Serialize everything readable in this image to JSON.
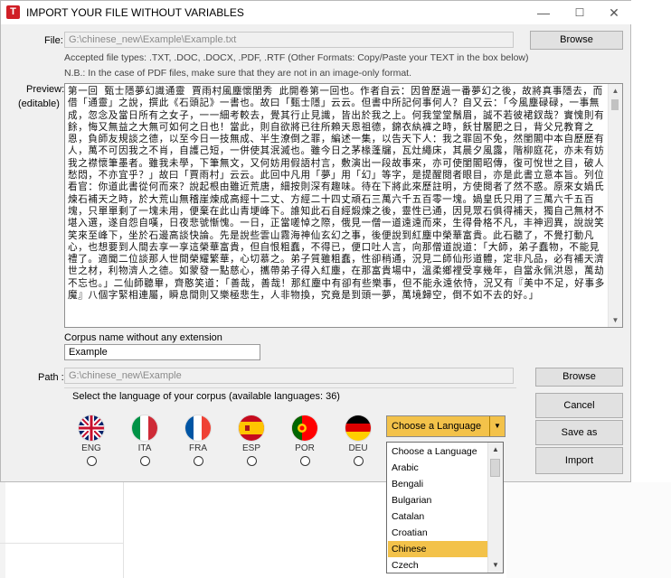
{
  "window": {
    "title": "IMPORT YOUR FILE WITHOUT VARIABLES",
    "icon_letter": "T",
    "controls": {
      "minimize": "—",
      "maximize": "☐",
      "close": "✕"
    }
  },
  "file": {
    "label": "File:",
    "value": "G:\\chinese_new\\Example\\Example.txt",
    "browse_label": "Browse",
    "accepted_types": "Accepted file types: .TXT, .DOC, .DOCX, .PDF, .RTF (Other Formats: Copy/Paste your TEXT in the box below)",
    "note": "N.B.: In the case of PDF files, make sure that they are not in an image-only format."
  },
  "preview": {
    "label_line1": "Preview:",
    "label_line2": "(editable)",
    "text": "第一回 甄士隱夢幻識通靈 賈雨村風塵懷閨秀 此開卷第一回也。作者自云：因曾歷過一番夢幻之後，故將真事隱去，而借「通靈」之說，撰此《石頭記》一書也。故曰「甄士隱」云云。但書中所記何事何人？自又云：「今風塵碌碌，一事無成，忽念及當日所有之女子，一一細考較去，覺其行止見識，皆出於我之上。何我堂堂鬚眉，誠不若彼裙釵哉？實愧則有餘，悔又無益之大無可如何之日也！當此，則自欲將已往所賴天恩祖德，錦衣紈褲之時，飫甘饜肥之日，背父兄教育之恩，負師友規談之德，以至今日一技無成、半生潦倒之罪，編述一集，以告天下人：我之罪固不免，然閨閣中本自歷歷有人，萬不可因我之不肖，自護己短，一併使其泯滅也。雖今日之茅椽蓬牖，瓦灶繩床，其晨夕風露，階柳庭花，亦未有妨我之襟懷筆墨者。雖我未學，下筆無文，又何妨用假語村言，敷演出一段故事來，亦可使閨閣昭傳，復可悅世之目，破人愁悶，不亦宜乎？」故曰「賈雨村」云云。此回中凡用「夢」用「幻」等字，是提醒閱者眼目，亦是此書立意本旨。列位看官：你道此書從何而來？說起根由雖近荒唐，細按則深有趣味。待在下將此來歷註明，方使閱者了然不惑。原來女媧氏煉石補天之時，於大荒山無稽崖煉成高經十二丈、方經二十四丈頑石三萬六千五百零一塊。媧皇氏只用了三萬六千五百塊，只單單剩了一塊未用，便棄在此山青埂峰下。誰知此石自經煅煉之後，靈性已通，因見眾石俱得補天，獨自己無材不堪入選，遂自怨自嘆，日夜悲號慚愧。一日，正當嗟悼之際，俄見一僧一道遠遠而來，生得骨格不凡，丰神迥異，說說笑笑來至峰下，坐於石邊高談快論。先是說些雲山霧海神仙玄幻之事，後便說到紅塵中榮華富貴。此石聽了，不覺打動凡心，也想要到人間去享一享這榮華富貴，但自恨粗蠢，不得已，便口吐人言，向那僧道說道：「大師，弟子蠢物，不能見禮了。適聞二位談那人世間榮耀繁華，心切慕之。弟子質雖粗蠢，性卻稍通，況見二師仙形道體，定非凡品，必有補天濟世之材，利物濟人之德。如蒙發一點慈心，攜帶弟子得入紅塵，在那富貴場中，溫柔鄉裡受享幾年，自當永佩洪恩，萬劫不忘也。」二仙師聽畢，齊憨笑道：「善哉，善哉！那紅塵中有卻有些樂事，但不能永遠依恃，況又有『美中不足，好事多魔』八個字緊相連屬，瞬息間則又樂極悲生，人非物換，究竟是到頭一夢，萬境歸空，倒不如不去的好。」"
  },
  "corpus": {
    "label": "Corpus name without any extension",
    "value": "Example"
  },
  "path": {
    "label": "Path :",
    "value": "G:\\chinese_new\\Example",
    "browse_label": "Browse"
  },
  "language": {
    "group_label": "Select the language of your corpus (available languages: 36)",
    "flags": [
      {
        "code": "ENG",
        "icon": "uk-flag-icon"
      },
      {
        "code": "ITA",
        "icon": "italy-flag-icon"
      },
      {
        "code": "FRA",
        "icon": "france-flag-icon"
      },
      {
        "code": "ESP",
        "icon": "spain-flag-icon"
      },
      {
        "code": "POR",
        "icon": "portugal-flag-icon"
      },
      {
        "code": "DEU",
        "icon": "germany-flag-icon"
      }
    ],
    "combo_value": "Choose a Language",
    "options": [
      "Choose a Language",
      "Arabic",
      "Bengali",
      "Bulgarian",
      "Catalan",
      "Croatian",
      "Chinese",
      "Czech"
    ],
    "highlighted": "Chinese"
  },
  "buttons": {
    "cancel": "Cancel",
    "save_as": "Save as",
    "import": "Import"
  },
  "colors": {
    "accent_highlight": "#f3c24a",
    "app_icon": "#d01f26",
    "window_bg": "#f0f0f0"
  }
}
